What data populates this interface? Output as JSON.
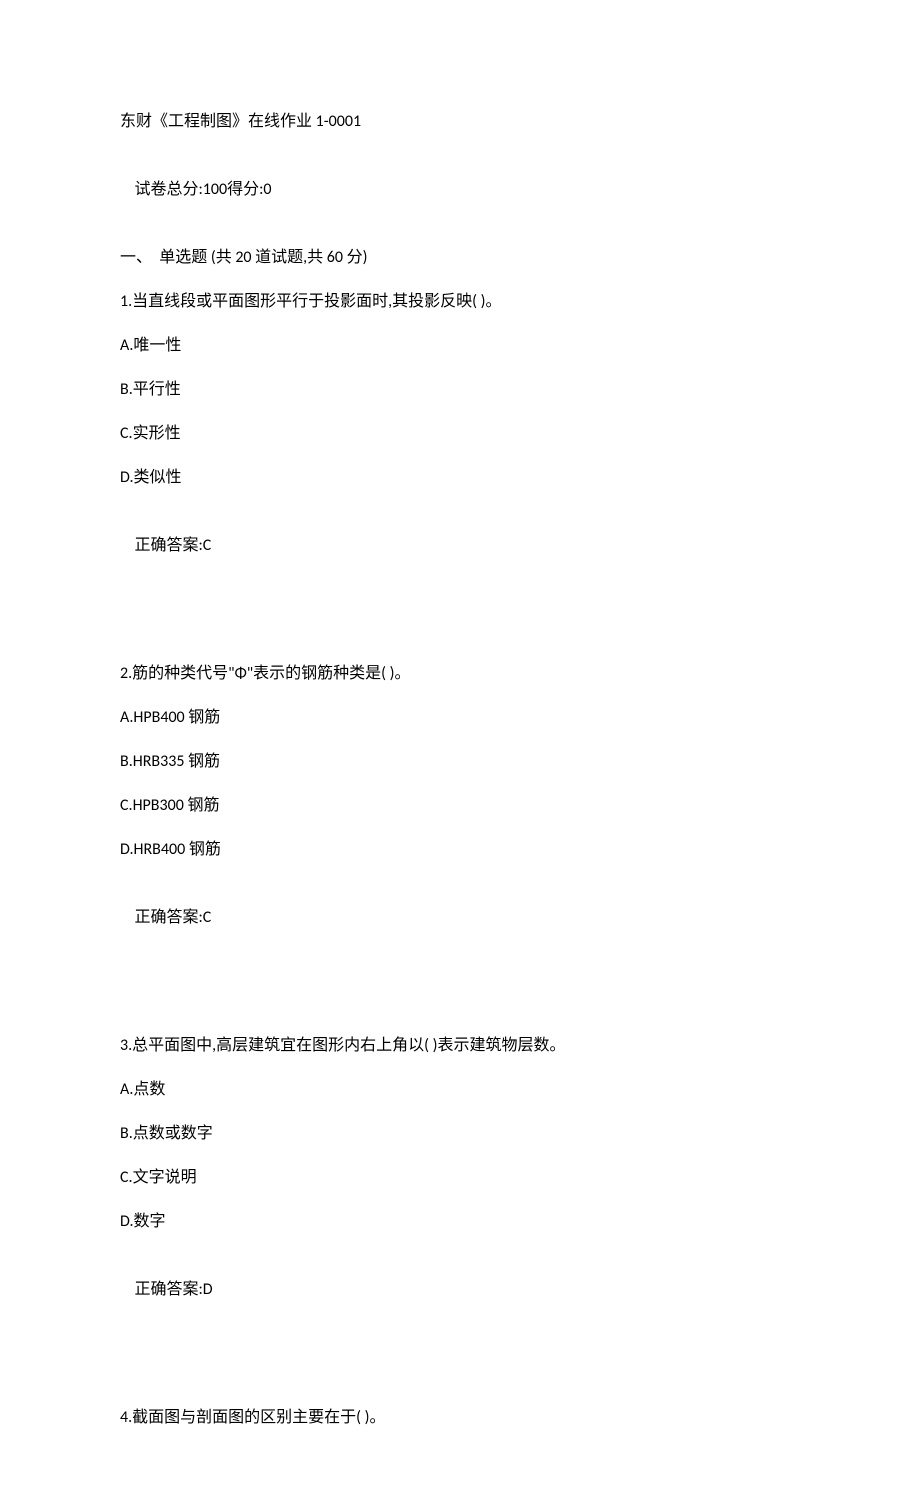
{
  "header": {
    "title": "东财《工程制图》在线作业 1-0001",
    "total_label": "试卷总分:",
    "total_value": "100",
    "score_label": "得分:",
    "score_value": "0",
    "section1": "一、  单选题 (共 20 道试题,共 60 分)"
  },
  "questions": [
    {
      "stem": "1.当直线段或平面图形平行于投影面时,其投影反映( )。",
      "options": [
        "A.唯一性",
        "B.平行性",
        "C.实形性",
        "D.类似性"
      ],
      "answer_label": "正确答案:",
      "answer_value": "C"
    },
    {
      "stem": "2.筋的种类代号\"Φ\"表示的钢筋种类是( )。",
      "options": [
        "A.HPB400 钢筋",
        "B.HRB335 钢筋",
        "C.HPB300 钢筋",
        "D.HRB400 钢筋"
      ],
      "answer_label": "正确答案:",
      "answer_value": "C"
    },
    {
      "stem": "3.总平面图中,高层建筑宜在图形内右上角以( )表示建筑物层数。",
      "options": [
        "A.点数",
        "B.点数或数字",
        "C.文字说明",
        "D.数字"
      ],
      "answer_label": "正确答案:",
      "answer_value": "D"
    },
    {
      "stem": "4.截面图与剖面图的区别主要在于( )。",
      "options": [],
      "answer_label": "",
      "answer_value": ""
    }
  ]
}
